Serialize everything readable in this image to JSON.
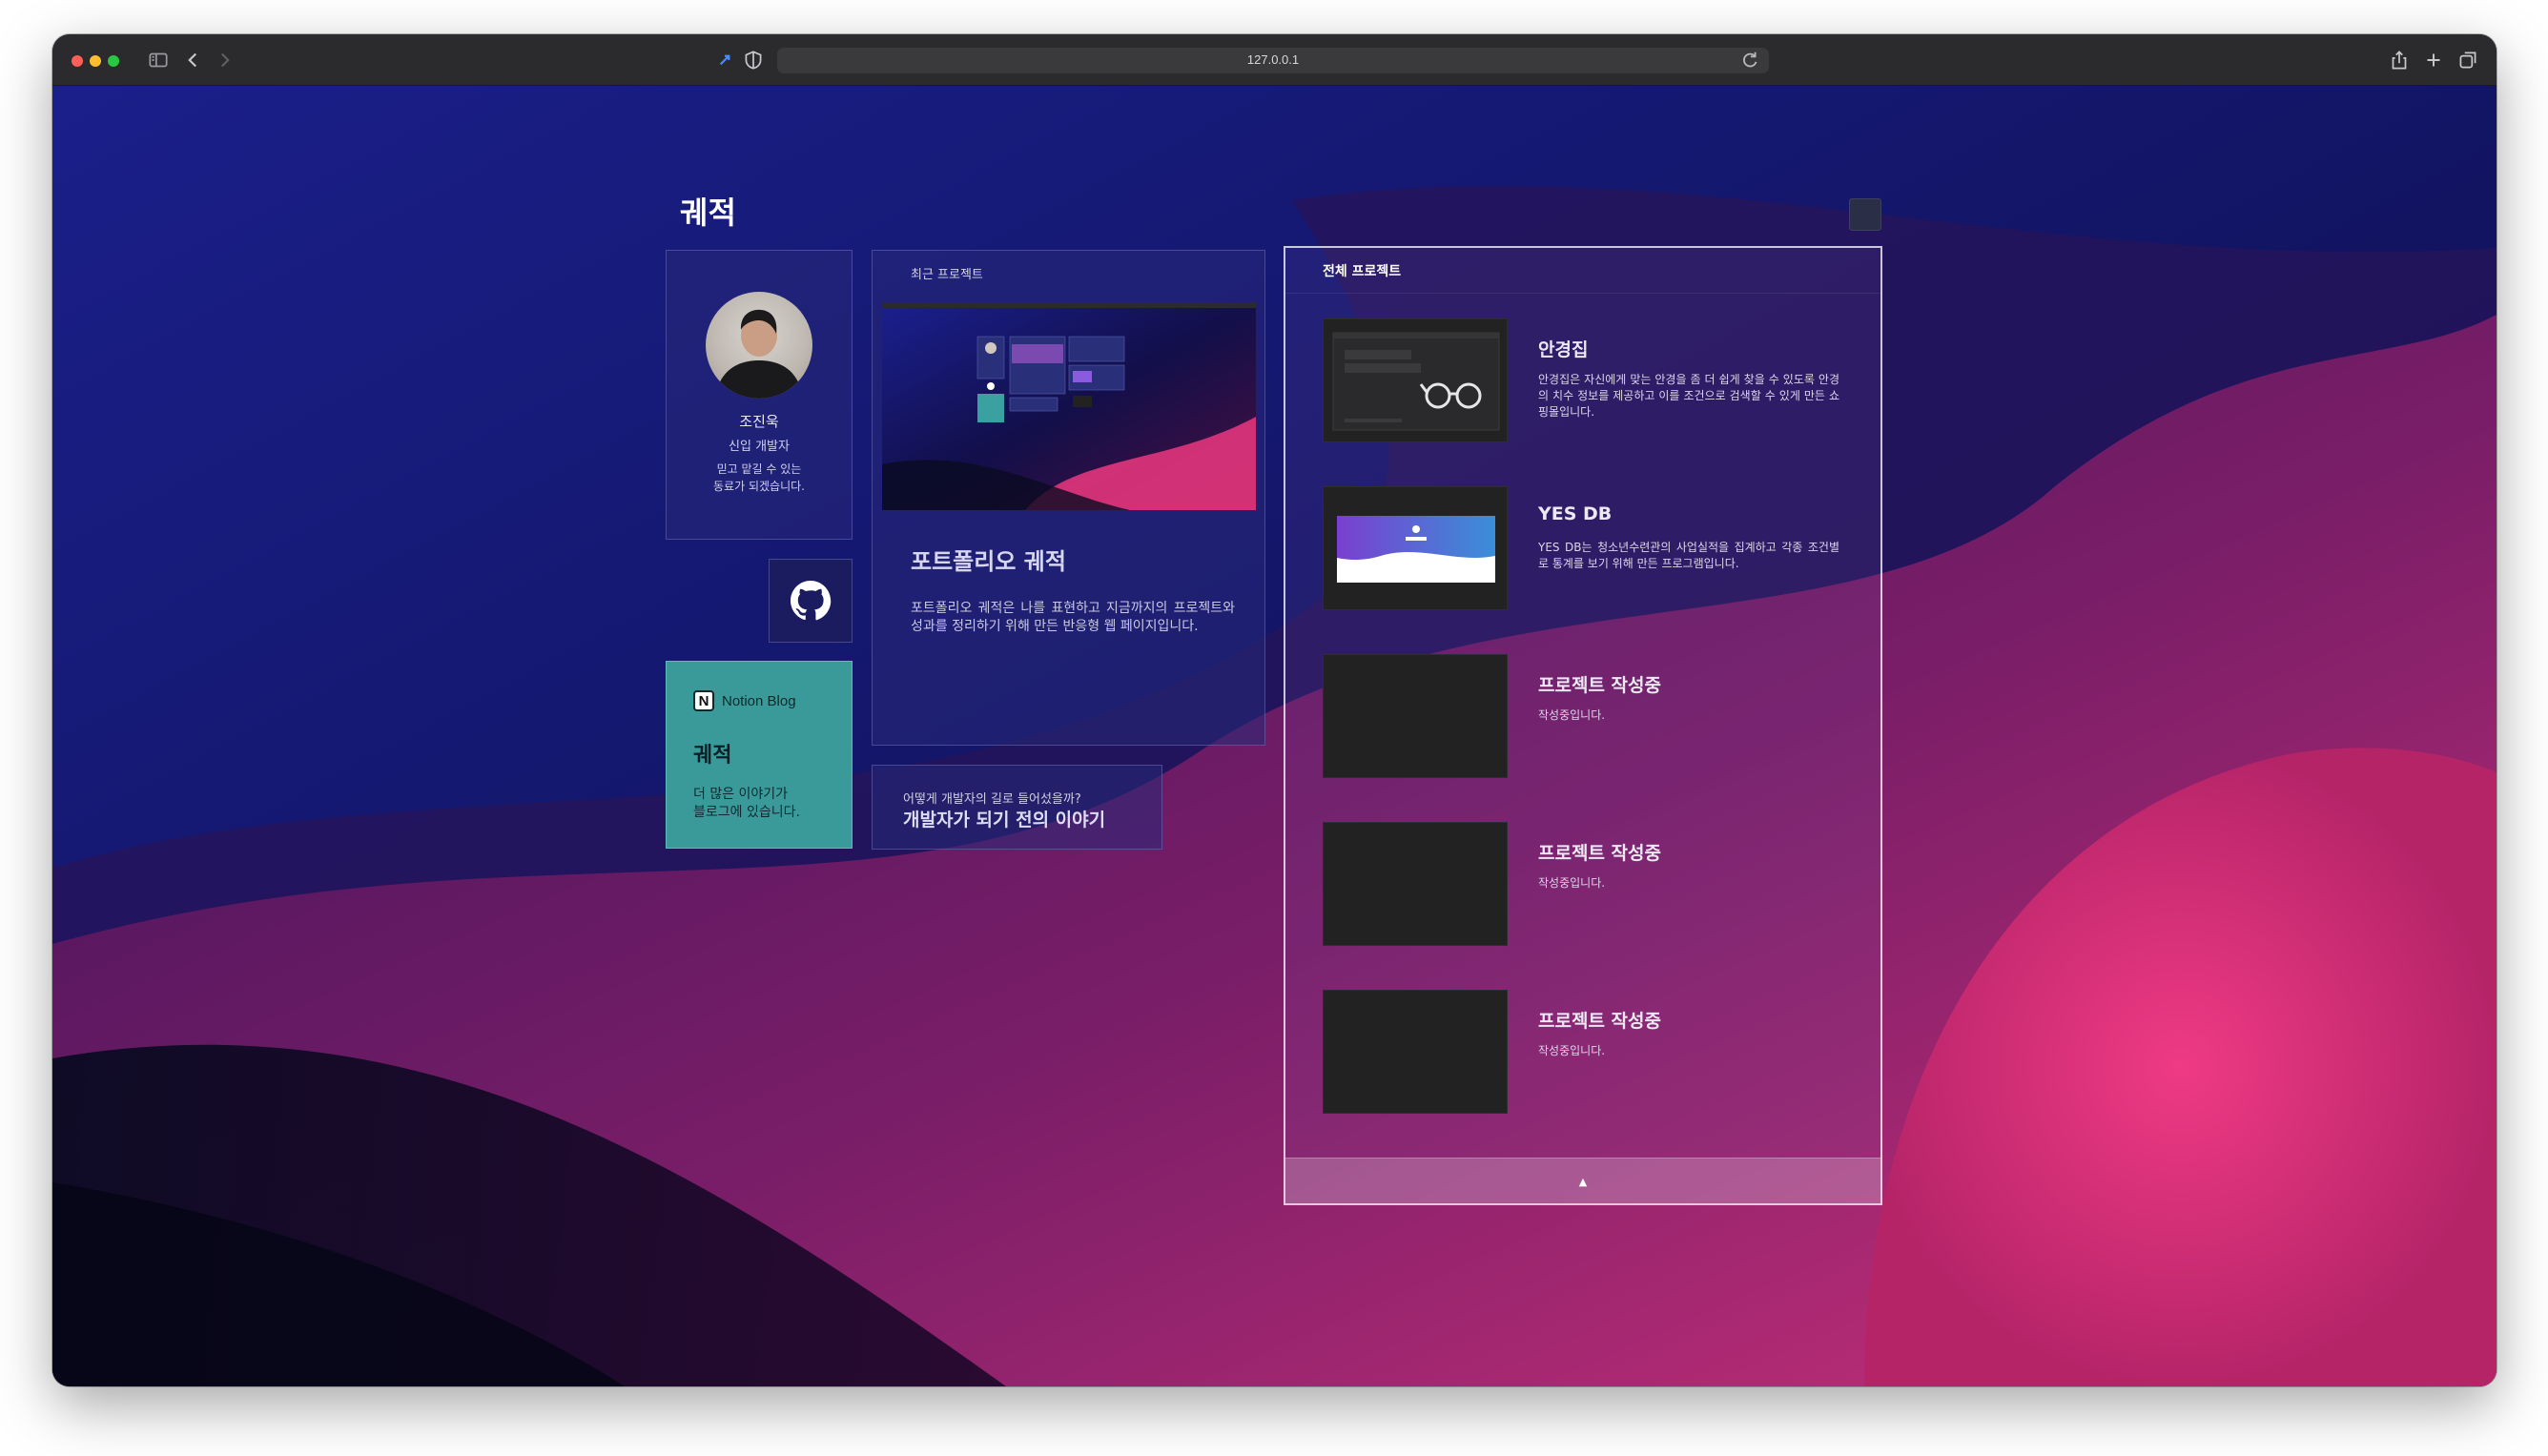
{
  "browser": {
    "url": "127.0.0.1"
  },
  "page": {
    "title": "궤적"
  },
  "profile": {
    "name": "조진욱",
    "role": "신입 개발자",
    "desc_line1": "믿고 맡길 수 있는",
    "desc_line2": "동료가 되겠습니다."
  },
  "notion": {
    "label": "Notion  Blog",
    "title": "궤적",
    "desc_line1": "더 많은 이야기가",
    "desc_line2": "블로그에 있습니다."
  },
  "recent": {
    "label": "최근 프로젝트",
    "title": "포트폴리오 궤적",
    "desc": "포트폴리오 궤적은 나를 표현하고 지금까지의 프로젝트와 성과를 정리하기 위해 만든 반응형 웹 페이지입니다."
  },
  "story": {
    "sub": "어떻게 개발자의 길로 들어섰을까?",
    "title": "개발자가 되기 전의 이야기"
  },
  "all_projects": {
    "label": "전체 프로젝트",
    "items": [
      {
        "title": "안경집",
        "desc": "안경집은 자신에게 맞는 안경을 좀 더 쉽게 찾을 수 있도록 안경의 치수 정보를 제공하고 이를 조건으로 검색할 수 있게 만든 쇼핑몰입니다."
      },
      {
        "title": "YES DB",
        "desc": "YES DB는 청소년수련관의 사업실적을 집계하고 각종 조건별로 통계를 보기 위해 만든 프로그램입니다."
      },
      {
        "title": "프로젝트 작성중",
        "desc": "작성중입니다."
      },
      {
        "title": "프로젝트 작성중",
        "desc": "작성중입니다."
      },
      {
        "title": "프로젝트 작성중",
        "desc": "작성중입니다."
      }
    ]
  },
  "icons": {
    "github": "github-icon",
    "notion": "notion-icon",
    "scroll_up": "chevron-up-icon"
  }
}
